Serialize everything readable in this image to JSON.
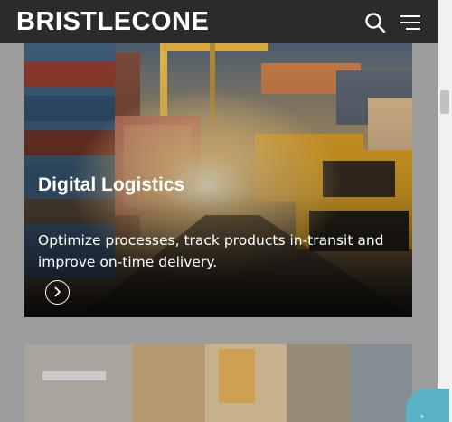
{
  "header": {
    "logo_text": "BRISTLECONE",
    "search_icon": "search-icon",
    "menu_icon": "hamburger-menu-icon"
  },
  "cards": [
    {
      "title": "Digital Logistics",
      "description": "Optimize processes, track products in-transit and improve on-time delivery.",
      "arrow_icon": "chevron-right-icon"
    }
  ],
  "colors": {
    "header_bg": "#2b2b2b",
    "page_bg": "#9c9c9c",
    "accent_teal": "#5ab3c5"
  }
}
